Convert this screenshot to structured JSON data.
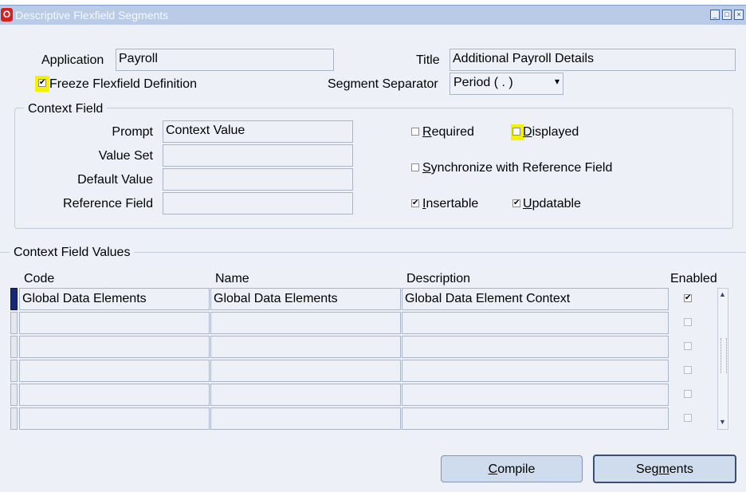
{
  "window": {
    "title": "Descriptive Flexfield Segments",
    "logo_glyph": "O",
    "minimize_glyph": "_",
    "maximize_glyph": "□",
    "close_glyph": "×"
  },
  "header": {
    "application_label": "Application",
    "application_value": "Payroll",
    "title_label": "Title",
    "title_value": "Additional Payroll Details",
    "freeze_label": "Freeze Flexfield Definition",
    "freeze_checked": true,
    "separator_label": "Segment Separator",
    "separator_value": "Period ( . )"
  },
  "context_field": {
    "group_label": "Context Field",
    "prompt_label": "Prompt",
    "prompt_value": "Context Value",
    "value_set_label": "Value Set",
    "value_set_value": "",
    "default_value_label": "Default Value",
    "default_value_value": "",
    "reference_field_label": "Reference Field",
    "reference_field_value": "",
    "required": {
      "label_first": "R",
      "label_rest": "equired",
      "checked": false
    },
    "displayed": {
      "label_first": "D",
      "label_rest": "isplayed",
      "checked": false
    },
    "synchronize": {
      "label_first": "S",
      "label_rest": "ynchronize with Reference Field",
      "checked": false
    },
    "insertable": {
      "label_first": "I",
      "label_rest": "nsertable",
      "checked": true
    },
    "updatable": {
      "label_first": "U",
      "label_rest": "pdatable",
      "checked": true
    }
  },
  "values_table": {
    "section_label": "Context Field Values",
    "columns": [
      "Code",
      "Name",
      "Description",
      "Enabled"
    ],
    "rows": [
      {
        "code": "Global Data Elements",
        "name": "Global Data Elements",
        "description": "Global Data Element Context",
        "enabled": true
      },
      {
        "code": "",
        "name": "",
        "description": "",
        "enabled": false
      },
      {
        "code": "",
        "name": "",
        "description": "",
        "enabled": false
      },
      {
        "code": "",
        "name": "",
        "description": "",
        "enabled": false
      },
      {
        "code": "",
        "name": "",
        "description": "",
        "enabled": false
      },
      {
        "code": "",
        "name": "",
        "description": "",
        "enabled": false
      }
    ]
  },
  "buttons": {
    "compile_first": "C",
    "compile_rest": "ompile",
    "segments_pre": "Seg",
    "segments_ul": "m",
    "segments_post": "ents"
  },
  "glyphs": {
    "check": "✔",
    "arrow_up": "▲",
    "arrow_down": "▼",
    "dropdown": "▾"
  },
  "colors": {
    "highlight": "#f4f200",
    "titlebar": "#b9cbe6",
    "active_row": "#182877"
  }
}
